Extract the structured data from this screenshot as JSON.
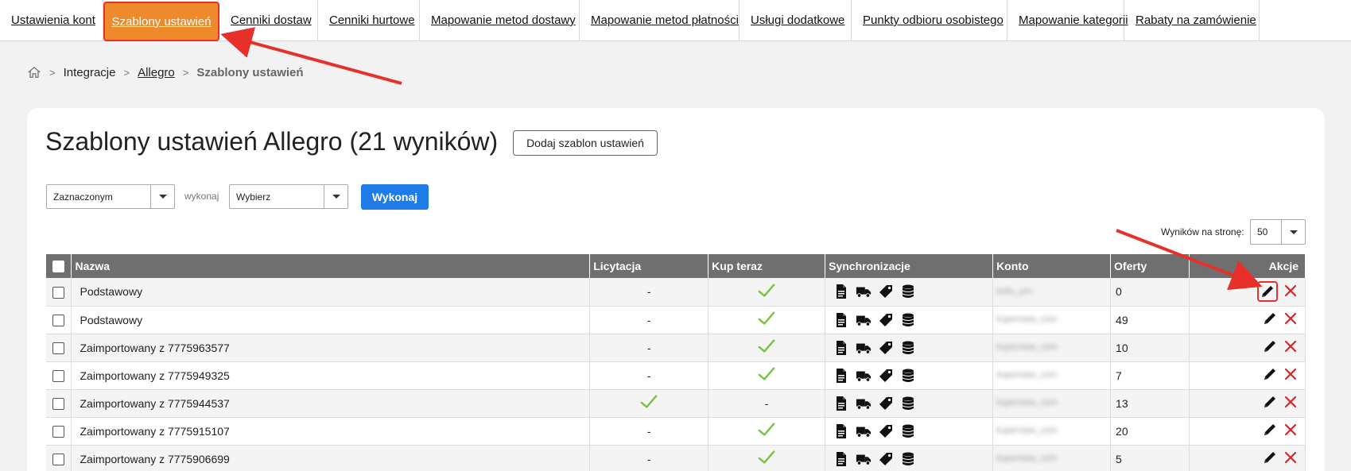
{
  "tabs": [
    {
      "label": "Ustawienia kont"
    },
    {
      "label": "Szablony ustawień"
    },
    {
      "label": "Cenniki dostaw"
    },
    {
      "label": "Cenniki hurtowe"
    },
    {
      "label": "Mapowanie metod dostawy"
    },
    {
      "label": "Mapowanie metod płatności"
    },
    {
      "label": "Usługi dodatkowe"
    },
    {
      "label": "Punkty odbioru osobistego"
    },
    {
      "label": "Mapowanie kategorii"
    },
    {
      "label": "Rabaty na zamówienie"
    }
  ],
  "breadcrumb": {
    "item1": "Integracje",
    "item2": "Allegro",
    "current": "Szablony ustawień"
  },
  "title": "Szablony ustawień Allegro (21 wyników)",
  "add_button": "Dodaj szablon ustawień",
  "bulk": {
    "scope_value": "Zaznaczonym",
    "action_label": "wykonaj",
    "action_value": "Wybierz",
    "run_button": "Wykonaj"
  },
  "per_page": {
    "label": "Wyników na stronę:",
    "value": "50"
  },
  "table": {
    "headers": {
      "name": "Nazwa",
      "auction": "Licytacja",
      "buynow": "Kup teraz",
      "sync": "Synchronizacje",
      "account": "Konto",
      "offers": "Oferty",
      "actions": "Akcje"
    },
    "rows": [
      {
        "name": "Podstawowy",
        "auction": "-",
        "buynow": true,
        "account": "kotlu_pro",
        "offers": "0"
      },
      {
        "name": "Podstawowy",
        "auction": "-",
        "buynow": true,
        "account": "kupemiaw_com",
        "offers": "49"
      },
      {
        "name": "Zaimportowany z 7775963577",
        "auction": "-",
        "buynow": true,
        "account": "kupemiaw_com",
        "offers": "10"
      },
      {
        "name": "Zaimportowany z 7775949325",
        "auction": "-",
        "buynow": true,
        "account": "kupemiaw_com",
        "offers": "7"
      },
      {
        "name": "Zaimportowany z 7775944537",
        "auction": true,
        "buynow": "-",
        "account": "kupemiaw_com",
        "offers": "13"
      },
      {
        "name": "Zaimportowany z 7775915107",
        "auction": "-",
        "buynow": true,
        "account": "kupemiaw_com",
        "offers": "20"
      },
      {
        "name": "Zaimportowany z 7775906699",
        "auction": "-",
        "buynow": true,
        "account": "kupemiaw_com",
        "offers": "5"
      }
    ]
  },
  "colors": {
    "active_tab": "#ee8a2c",
    "highlight": "#e8302a",
    "primary_button": "#1f7be6",
    "check": "#7ac143",
    "delete": "#d9252a"
  }
}
